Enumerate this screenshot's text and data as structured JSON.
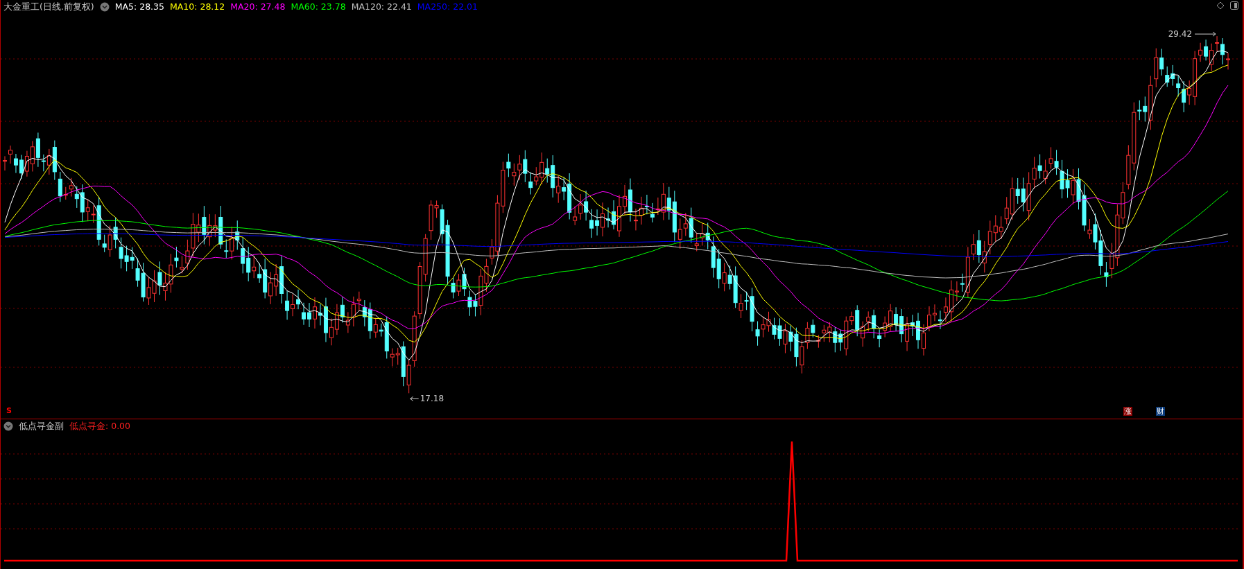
{
  "chart_header": {
    "title": "大金重工(日线.前复权)",
    "moving_averages": [
      {
        "label": "MA5: 28.35",
        "color": "#ffffff"
      },
      {
        "label": "MA10: 28.12",
        "color": "#ffff00"
      },
      {
        "label": "MA20: 27.48",
        "color": "#ff00ff"
      },
      {
        "label": "MA60: 23.78",
        "color": "#00ff00"
      },
      {
        "label": "MA120: 22.41",
        "color": "#c0c0c0"
      },
      {
        "label": "MA250: 22.01",
        "color": "#0000ff"
      }
    ]
  },
  "price_chart": {
    "high_label": "29.42",
    "low_label": "17.18",
    "signal_mark": "S",
    "event_markers": [
      {
        "label": "涨",
        "color": "#8b0000"
      },
      {
        "label": "财",
        "color": "#0a3a7a"
      }
    ]
  },
  "indicator_panel": {
    "name": "低点寻金副",
    "reading": "低点寻金: 0.00"
  }
}
